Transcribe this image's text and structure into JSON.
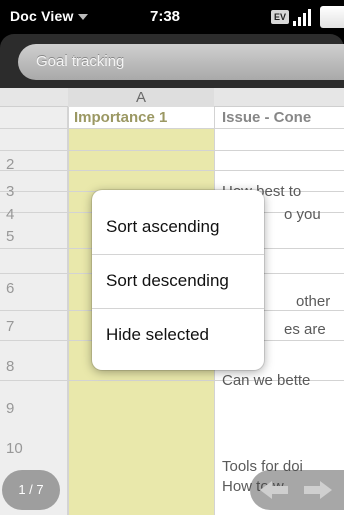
{
  "status_bar": {
    "app_menu_label": "Doc View",
    "time": "7:38",
    "ev_badge": "EV"
  },
  "header": {
    "title": "Goal tracking"
  },
  "sheet": {
    "column_a_label": "A",
    "header_row": {
      "col_a": "Importance 1",
      "col_b": "Issue - Cone"
    },
    "row_numbers": [
      "2",
      "3",
      "4",
      "5",
      "6",
      "7",
      "8",
      "9",
      "10"
    ],
    "visible_cell_fragments": {
      "row3": "How best to",
      "row4": "o you",
      "row6": "other",
      "row7": "es are",
      "row8": "Can we bette",
      "row10a": "Tools for doi",
      "row10b": "How to w"
    }
  },
  "context_menu": {
    "items": [
      {
        "label": "Sort ascending"
      },
      {
        "label": "Sort descending"
      },
      {
        "label": "Hide selected"
      }
    ]
  },
  "footer": {
    "page_indicator": "1 / 7"
  }
}
